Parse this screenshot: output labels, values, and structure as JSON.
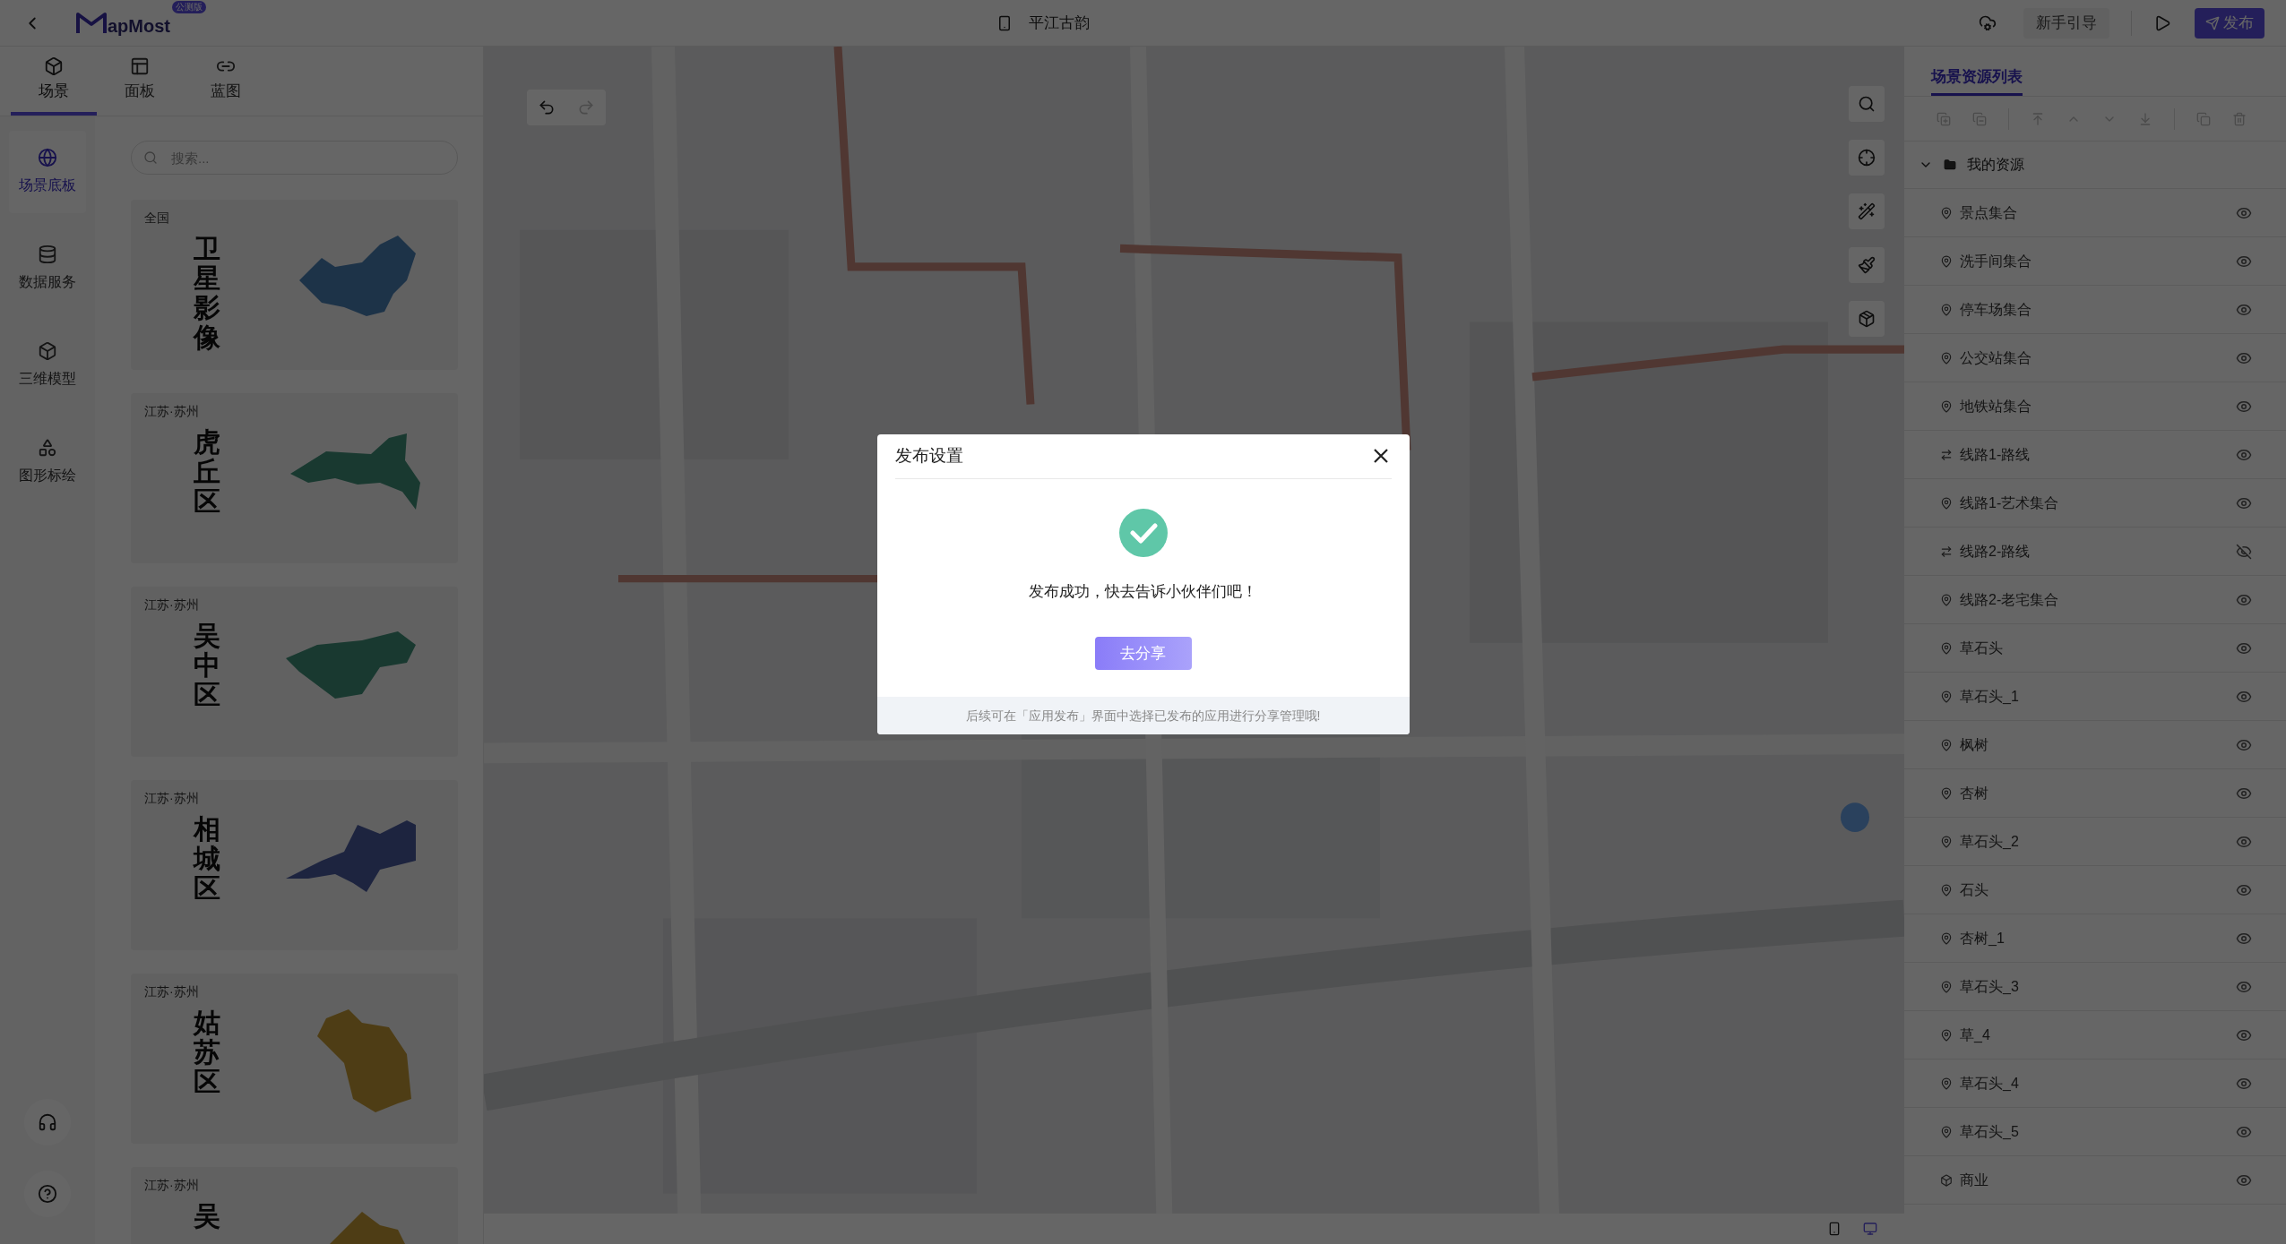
{
  "top_bar": {
    "logo_text": "apMost",
    "badge": "公测版",
    "project_title": "平江古韵",
    "guide_button": "新手引导",
    "publish_button": "发布"
  },
  "left_tabs": [
    {
      "label": "场景",
      "selected": true
    },
    {
      "label": "面板",
      "selected": false
    },
    {
      "label": "蓝图",
      "selected": false
    }
  ],
  "rail_items": [
    {
      "label": "场景底板",
      "selected": true
    },
    {
      "label": "数据服务",
      "selected": false
    },
    {
      "label": "三维模型",
      "selected": false
    },
    {
      "label": "图形标绘",
      "selected": false
    }
  ],
  "search": {
    "placeholder": "搜索..."
  },
  "base_cards": [
    {
      "region": "全国",
      "name": "卫星影像"
    },
    {
      "region": "江苏·苏州",
      "name": "虎丘区"
    },
    {
      "region": "江苏·苏州",
      "name": "吴中区"
    },
    {
      "region": "江苏·苏州",
      "name": "相城区"
    },
    {
      "region": "江苏·苏州",
      "name": "姑苏区"
    },
    {
      "region": "江苏·苏州",
      "name": "吴"
    }
  ],
  "right_panel": {
    "tab": {
      "label": "场景资源列表",
      "selected": true
    },
    "tree": {
      "label": "我的资源",
      "expanded": true,
      "children": [
        {
          "label": "景点集合",
          "kind": "point",
          "visible": true
        },
        {
          "label": "洗手间集合",
          "kind": "point",
          "visible": true
        },
        {
          "label": "停车场集合",
          "kind": "point",
          "visible": true
        },
        {
          "label": "公交站集合",
          "kind": "point",
          "visible": true
        },
        {
          "label": "地铁站集合",
          "kind": "point",
          "visible": true
        },
        {
          "label": "线路1-路线",
          "kind": "route",
          "visible": true
        },
        {
          "label": "线路1-艺术集合",
          "kind": "point",
          "visible": true
        },
        {
          "label": "线路2-路线",
          "kind": "route",
          "visible": false
        },
        {
          "label": "线路2-老宅集合",
          "kind": "point",
          "visible": true
        },
        {
          "label": "草石头",
          "kind": "point",
          "visible": true
        },
        {
          "label": "草石头_1",
          "kind": "point",
          "visible": true
        },
        {
          "label": "枫树",
          "kind": "point",
          "visible": true
        },
        {
          "label": "杏树",
          "kind": "point",
          "visible": true
        },
        {
          "label": "草石头_2",
          "kind": "point",
          "visible": true
        },
        {
          "label": "石头",
          "kind": "point",
          "visible": true
        },
        {
          "label": "杏树_1",
          "kind": "point",
          "visible": true
        },
        {
          "label": "草石头_3",
          "kind": "point",
          "visible": true
        },
        {
          "label": "草_4",
          "kind": "point",
          "visible": true
        },
        {
          "label": "草石头_4",
          "kind": "point",
          "visible": true
        },
        {
          "label": "草石头_5",
          "kind": "point",
          "visible": true
        },
        {
          "label": "商业",
          "kind": "model",
          "visible": true
        }
      ]
    }
  },
  "dialog": {
    "title": "发布设置",
    "message": "发布成功，快去告诉小伙伴们吧！",
    "share_button": "去分享",
    "footer_note": "后续可在「应用发布」界面中选择已发布的应用进行分享管理哦!"
  }
}
